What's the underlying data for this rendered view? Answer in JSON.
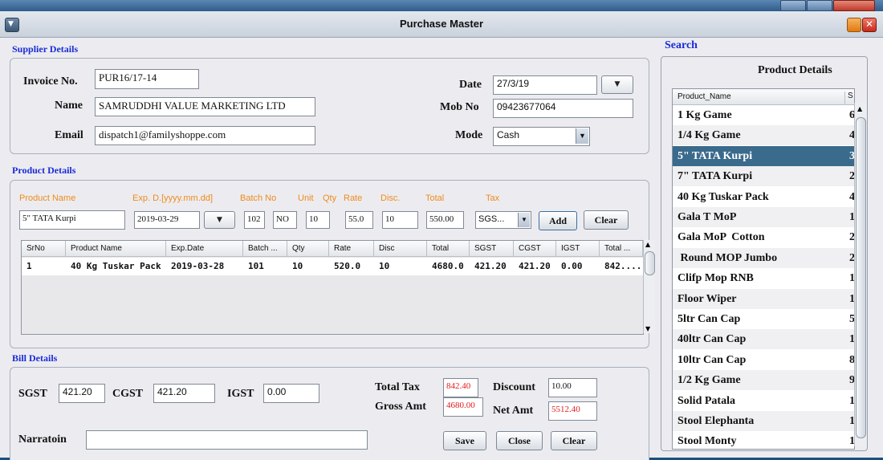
{
  "window": {
    "title": "Purchase Master"
  },
  "supplier": {
    "section_title": "Supplier Details",
    "invoice_label": "Invoice No.",
    "invoice_value": "PUR16/17-14",
    "name_label": "Name",
    "name_value": "SAMRUDDHI VALUE MARKETING LTD",
    "email_label": "Email",
    "email_value": "dispatch1@familyshoppe.com",
    "date_label": "Date",
    "date_value": "27/3/19",
    "mob_label": "Mob No",
    "mob_value": "09423677064",
    "mode_label": "Mode",
    "mode_value": "Cash"
  },
  "product": {
    "section_title": "Product Details",
    "labels": {
      "product_name": "Product Name",
      "exp_date": "Exp. D.[yyyy.mm.dd]",
      "batch_no": "Batch No",
      "unit": "Unit",
      "qty": "Qty",
      "rate": "Rate",
      "disc": "Disc.",
      "total": "Total",
      "tax": "Tax"
    },
    "values": {
      "product_name": "5\" TATA Kurpi",
      "exp_date": "2019-03-29",
      "batch_no": "102",
      "unit": "NO",
      "qty": "10",
      "rate": "55.0",
      "disc": "10",
      "total": "550.00",
      "tax": "SGS..."
    },
    "add_label": "Add",
    "clear_label": "Clear"
  },
  "table": {
    "columns": [
      "SrNo",
      "Product Name",
      "Exp.Date",
      "Batch ...",
      "Qty",
      "Rate",
      "Disc",
      "Total",
      "SGST",
      "CGST",
      "IGST",
      "Total ..."
    ],
    "rows": [
      [
        "1",
        "40 Kg Tuskar Pack",
        "2019-03-28",
        "101",
        "10",
        "520.0",
        "10",
        "4680.0",
        "421.20",
        "421.20",
        "0.00",
        "842...."
      ]
    ]
  },
  "bill": {
    "section_title": "Bill Details",
    "sgst_label": "SGST",
    "sgst_value": "421.20",
    "cgst_label": "CGST",
    "cgst_value": "421.20",
    "igst_label": "IGST",
    "igst_value": "0.00",
    "total_tax_label": "Total Tax",
    "total_tax_value": "842.40",
    "gross_label": "Gross Amt",
    "gross_value": "4680.00",
    "discount_label": "Discount",
    "discount_value": "10.00",
    "net_label": "Net Amt",
    "net_value": "5512.40",
    "narration_label": "Narratoin",
    "narration_value": "",
    "save_label": "Save",
    "close_label": "Close",
    "clear_label": "Clear"
  },
  "search": {
    "label": "Search",
    "panel_title": "Product Details",
    "col_name": "Product_Name",
    "col_second": "S",
    "items": [
      {
        "name": "1 Kg Game",
        "second": "6"
      },
      {
        "name": "1/4 Kg Game",
        "second": "4"
      },
      {
        "name": "5\" TATA Kurpi",
        "second": "3"
      },
      {
        "name": "7\" TATA Kurpi",
        "second": "2"
      },
      {
        "name": "40 Kg Tuskar Pack",
        "second": "4"
      },
      {
        "name": "Gala T MoP",
        "second": "1"
      },
      {
        "name": "Gala MoP  Cotton",
        "second": "2"
      },
      {
        "name": " Round MOP Jumbo",
        "second": "2"
      },
      {
        "name": "Clifp Mop RNB",
        "second": "1"
      },
      {
        "name": "Floor Wiper",
        "second": "1"
      },
      {
        "name": "5ltr Can Cap",
        "second": "5"
      },
      {
        "name": "40ltr Can Cap",
        "second": "1"
      },
      {
        "name": "10ltr Can Cap",
        "second": "8"
      },
      {
        "name": "1/2 Kg Game",
        "second": "9"
      },
      {
        "name": "Solid Patala",
        "second": "1"
      },
      {
        "name": "Stool Elephanta",
        "second": "1"
      },
      {
        "name": "Stool Monty",
        "second": "1"
      }
    ],
    "selected_index": 2
  },
  "colors": {
    "accent": "#1a2bd6",
    "label_orange": "#f08a1c",
    "value_red": "#e31c1c",
    "selection": "#3a6a8c"
  }
}
